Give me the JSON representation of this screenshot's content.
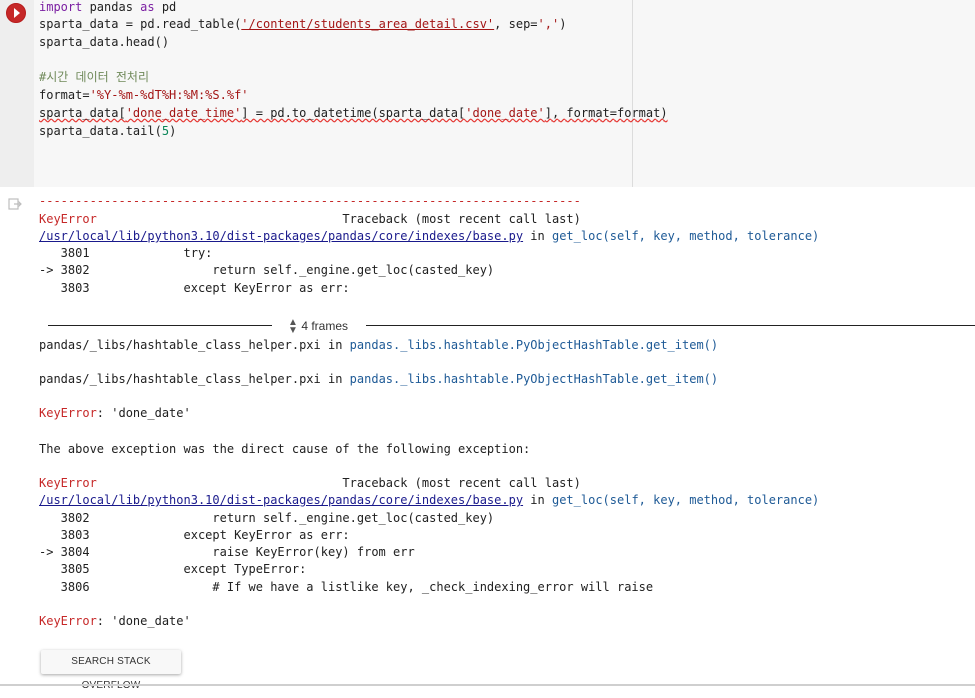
{
  "code": {
    "l1_kw1": "import",
    "l1_mod": " pandas ",
    "l1_kw2": "as",
    "l1_alias": " pd",
    "l2_pre": "sparta_data = pd.read_table(",
    "l2_str": "'/content/students_area_detail.csv'",
    "l2_mid": ", sep=",
    "l2_sep": "','",
    "l2_end": ")",
    "l3": "sparta_data.head()",
    "l5_cmt": "#시간 데이터 전처리",
    "l6_pre": "format=",
    "l6_str": "'%Y-%m-%dT%H:%M:%S.%f'",
    "l7_a": "sparta_data[",
    "l7_s1": "'done_date_time'",
    "l7_b": "] = pd.to_datetime(sparta_data[",
    "l7_s2": "'done_date'",
    "l7_c": "], format=format)",
    "l8_pre": "sparta_data.tail(",
    "l8_num": "5",
    "l8_end": ")"
  },
  "output": {
    "dashes": "---------------------------------------------------------------------------",
    "tb1_err": "KeyError",
    "tb1_head": "                                  Traceback (most recent call last)",
    "tb1_path": "/usr/local/lib/python3.10/dist-packages/pandas/core/indexes/base.py",
    "tb1_in": " in ",
    "tb1_fn": "get_loc(self, key, method, tolerance)",
    "tb1_l1": "   3801             try:",
    "tb1_l2": "-> 3802                 return self._engine.get_loc(casted_key)",
    "tb1_l3": "   3803             except KeyError as err:",
    "frames_label": "4 frames",
    "pxi1_path": "pandas/_libs/hashtable_class_helper.pxi",
    "pxi1_in": " in ",
    "pxi1_fn": "pandas._libs.hashtable.PyObjectHashTable.get_item()",
    "pxi2_path": "pandas/_libs/hashtable_class_helper.pxi",
    "pxi2_in": " in ",
    "pxi2_fn": "pandas._libs.hashtable.PyObjectHashTable.get_item()",
    "ke1_err": "KeyError",
    "ke1_msg": ": 'done_date'",
    "cause": "The above exception was the direct cause of the following exception:",
    "tb2_err": "KeyError",
    "tb2_head": "                                  Traceback (most recent call last)",
    "tb2_path": "/usr/local/lib/python3.10/dist-packages/pandas/core/indexes/base.py",
    "tb2_in": " in ",
    "tb2_fn": "get_loc(self, key, method, tolerance)",
    "tb2_l1": "   3802                 return self._engine.get_loc(casted_key)",
    "tb2_l2": "   3803             except KeyError as err:",
    "tb2_l3": "-> 3804                 raise KeyError(key) from err",
    "tb2_l4": "   3805             except TypeError:",
    "tb2_l5": "   3806                 # If we have a listlike key, _check_indexing_error will raise",
    "ke2_err": "KeyError",
    "ke2_msg": ": 'done_date'",
    "so_button": "SEARCH STACK OVERFLOW"
  },
  "colors": {
    "error": "#c62828",
    "keyword": "#7b1fa2",
    "string": "#a31515",
    "comment": "#708a5a",
    "number": "#098658"
  },
  "icons": {
    "run": "run-cell-icon",
    "output": "output-icon",
    "frames": "expand-frames-icon"
  }
}
